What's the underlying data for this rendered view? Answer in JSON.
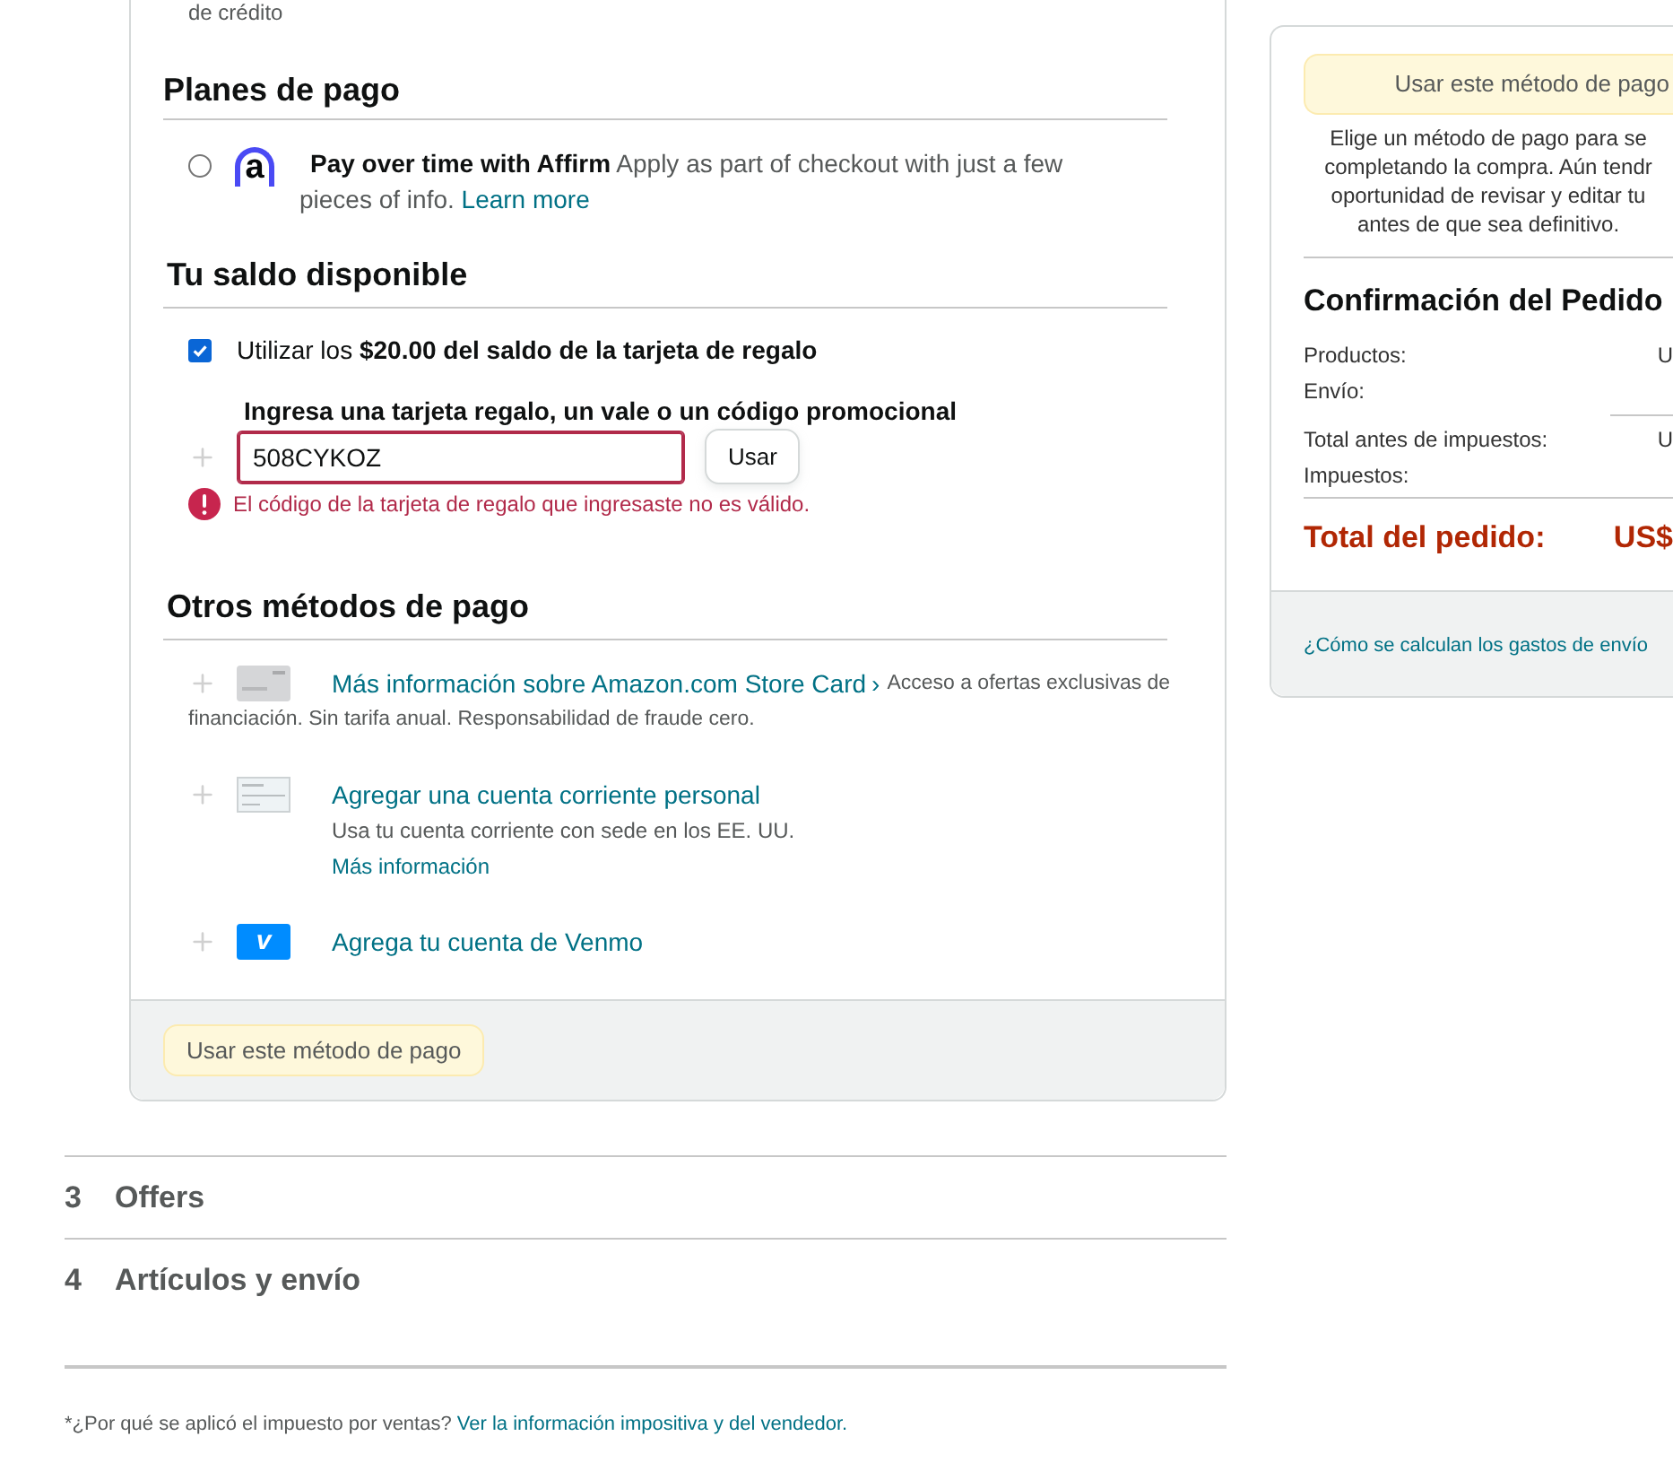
{
  "top_text": "de crédito",
  "payment_plans": {
    "heading": "Planes de pago",
    "options": [
      {
        "selected": false,
        "logo_text": "a",
        "title": "Pay over time with Affirm",
        "description": "Apply as part of checkout with just a few pieces of info.",
        "link": "Learn more"
      }
    ]
  },
  "balance": {
    "heading": "Tu saldo disponible",
    "gift_card": {
      "checked": true,
      "text": "Utilizar los **$20.00 del saldo de la tarjeta de regalo**"
    },
    "code_label": "Ingresa una tarjeta regalo, un vale o un código promocional",
    "code_value": "508CYKOZ",
    "apply_button": "Usar",
    "error": "El código de la tarjeta de regalo que ingresaste no es válido."
  },
  "other_methods": {
    "heading": "Otros métodos de pago",
    "items": [
      {
        "kind": "store_card",
        "link": "Más información sobre Amazon.com Store Card",
        "chevron": "›",
        "description_lines": [
          "Acceso a ofertas exclusivas de",
          "financiación. Sin tarifa anual. Responsabilidad de fraude cero."
        ]
      },
      {
        "kind": "checking",
        "link": "Agregar una cuenta corriente personal",
        "description": "Usa tu cuenta corriente con sede en los EE. UU.",
        "more_link": "Más información"
      },
      {
        "kind": "venmo",
        "logo_text": "v",
        "link": "Agrega tu cuenta de Venmo"
      }
    ]
  },
  "footer_button": "Usar este método de pago",
  "steps": [
    {
      "number": "3",
      "title": "Offers"
    },
    {
      "number": "4",
      "title": "Artículos y envío"
    }
  ],
  "footnote": {
    "text": "*¿Por qué se aplicó el impuesto por ventas?",
    "link": "Ver la información impositiva y del vendedor."
  },
  "summary": {
    "button": "Usar este método de pago",
    "note_lines": [
      "Elige un método de pago para se",
      "completando la compra. Aún tendr",
      "oportunidad de revisar y editar tu",
      "antes de que sea definitivo."
    ],
    "title": "Confirmación del Pedido",
    "rows": [
      {
        "label": "Productos:",
        "value": "U"
      },
      {
        "label": "Envío:"
      },
      {
        "label": "Total antes de impuestos:",
        "value": "U",
        "rule_before": true
      },
      {
        "label": "Impuestos:"
      }
    ],
    "total": {
      "label": "Total del pedido:",
      "value": "US$"
    },
    "shipping_link": "¿Cómo se calculan los gastos de envío"
  }
}
